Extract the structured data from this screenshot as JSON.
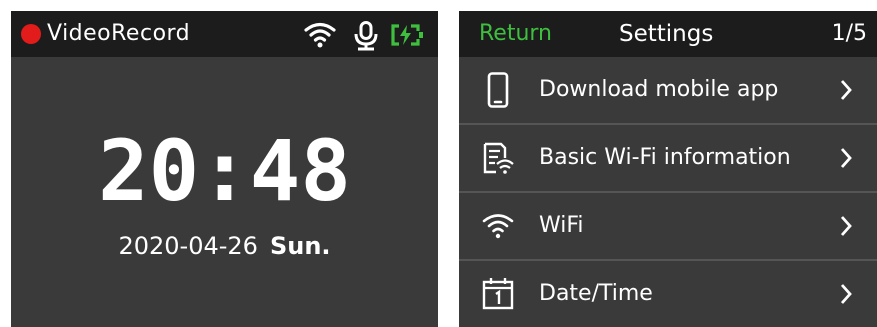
{
  "left_screen": {
    "status_bar": {
      "mode_label": "VideoRecord",
      "rec_indicator_color": "#e21b1b",
      "icons": [
        "wifi-icon",
        "microphone-icon",
        "battery-charging-icon"
      ]
    },
    "clock": {
      "time": "20:48",
      "date": "2020-04-26",
      "weekday": "Sun."
    }
  },
  "right_screen": {
    "header": {
      "return_label": "Return",
      "title": "Settings",
      "page_indicator": "1/5",
      "return_color": "#3fbf3f"
    },
    "menu_items": [
      {
        "label": "Download mobile app",
        "icon": "smartphone-icon"
      },
      {
        "label": "Basic Wi-Fi information",
        "icon": "wifi-info-icon"
      },
      {
        "label": "WiFi",
        "icon": "wifi-icon"
      },
      {
        "label": "Date/Time",
        "icon": "calendar-icon"
      }
    ]
  }
}
